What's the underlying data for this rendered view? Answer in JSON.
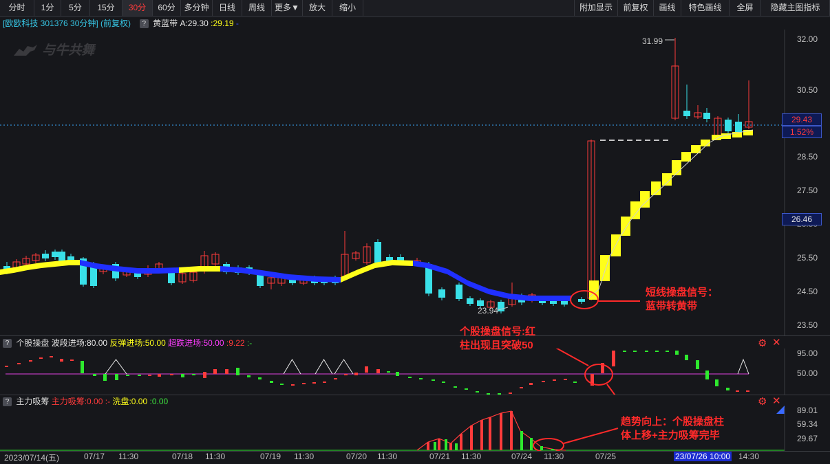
{
  "toolbar": {
    "left": [
      "分时",
      "1分",
      "5分",
      "15分",
      "30分",
      "60分",
      "多分钟",
      "日线",
      "周线",
      "更多▼",
      "放大",
      "缩小"
    ],
    "active": "30分",
    "right": [
      "附加显示",
      "前复权",
      "画线",
      "特色画线",
      "全屏",
      "隐藏主图指标"
    ]
  },
  "header": {
    "stock": "[欧欧科技 301376 30分钟] (前复权)",
    "indicator_name": "黄蓝带",
    "a_label": "A:29.30",
    "b_label": ":29.19",
    "b_suffix": "-"
  },
  "watermark": "与牛共舞",
  "main_chart": {
    "yticks": [
      "32.00",
      "30.50",
      "28.50",
      "27.50",
      "26.50",
      "25.50",
      "24.50",
      "23.50"
    ],
    "current_price_badge": "29.43",
    "change_badge": "1.52%",
    "crosshair_badge": "26.46",
    "high_label": "31.99",
    "low_label": "23.94"
  },
  "indicator1": {
    "name": "个股操盘",
    "p1": "波段进场:80.00",
    "p2": "反弹进场:50.00",
    "p3": "超跌进场:50.00",
    "p4": ":9.22",
    "p5": ":-",
    "yticks": [
      "95.00",
      "50.00"
    ]
  },
  "indicator2": {
    "name": "主力吸筹",
    "p1": "主力吸筹:0.00",
    "p1_prefix": ":-",
    "p2": "洗盘:0.00",
    "p3": ":0.00",
    "yticks": [
      "89.01",
      "59.34",
      "29.67"
    ]
  },
  "dates": [
    {
      "label": "2023/07/14(五)",
      "highlight": false
    },
    {
      "label": "07/17",
      "highlight": false
    },
    {
      "label": "11:30",
      "highlight": false
    },
    {
      "label": "07/18",
      "highlight": false
    },
    {
      "label": "11:30",
      "highlight": false
    },
    {
      "label": "07/19",
      "highlight": false
    },
    {
      "label": "11:30",
      "highlight": false
    },
    {
      "label": "07/20",
      "highlight": false
    },
    {
      "label": "11:30",
      "highlight": false
    },
    {
      "label": "07/21",
      "highlight": false
    },
    {
      "label": "11:30",
      "highlight": false
    },
    {
      "label": "07/24",
      "highlight": false
    },
    {
      "label": "11:30",
      "highlight": false
    },
    {
      "label": "07/25",
      "highlight": false
    },
    {
      "label": "23/07/26 10:00",
      "highlight": true
    },
    {
      "label": "14:30",
      "highlight": false
    }
  ],
  "annotations": {
    "a1_line1": "短线操盘信号：",
    "a1_line2": "蓝带转黄带",
    "a2_line1": "个股操盘信号:红",
    "a2_line2": "柱出现且突破50",
    "a3_line1": "趋势向上：个股操盘柱",
    "a3_line2": "体上移+主力吸筹完毕"
  },
  "colors": {
    "up": "#ff3b3b",
    "down": "#39e0e8",
    "yellow_band": "#ffff1a",
    "blue_band": "#2030ff",
    "annotation": "#ff2a2a"
  }
}
